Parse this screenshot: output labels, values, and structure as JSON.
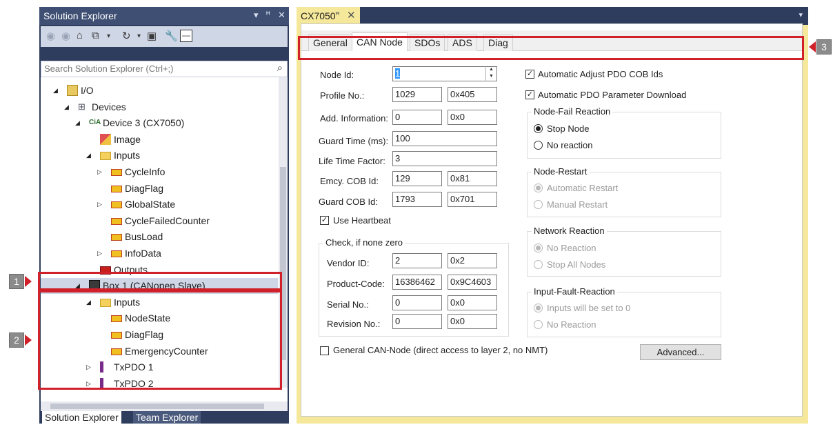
{
  "solution_explorer": {
    "title": "Solution Explorer",
    "title_controls": [
      "▾",
      "ꟸ",
      "✕"
    ],
    "search_placeholder": "Search Solution Explorer (Ctrl+;)",
    "tree": [
      {
        "label": "I/O",
        "icon": "io-folder-icon",
        "arrow": "◢"
      },
      {
        "label": "Devices",
        "icon": "devices-icon",
        "arrow": "◢"
      },
      {
        "label": "Device 3 (CX7050)",
        "icon": "cia-icon",
        "icon_text": "CiA",
        "arrow": "◢"
      },
      {
        "label": "Image",
        "icon": "image-icon",
        "arrow": ""
      },
      {
        "label": "Inputs",
        "icon": "folder-icon",
        "arrow": "◢"
      },
      {
        "label": "CycleInfo",
        "icon": "input-var-icon",
        "arrow": "▷"
      },
      {
        "label": "DiagFlag",
        "icon": "input-var-icon",
        "arrow": ""
      },
      {
        "label": "GlobalState",
        "icon": "input-var-icon",
        "arrow": "▷"
      },
      {
        "label": "CycleFailedCounter",
        "icon": "input-var-icon",
        "arrow": ""
      },
      {
        "label": "BusLoad",
        "icon": "input-var-icon",
        "arrow": ""
      },
      {
        "label": "InfoData",
        "icon": "input-var-icon",
        "arrow": "▷"
      },
      {
        "label": "Outputs",
        "icon": "outputs-icon",
        "arrow": ""
      },
      {
        "label": "Box 1 (CANopen Slave)",
        "icon": "box-icon",
        "arrow": "◢"
      },
      {
        "label": "Inputs",
        "icon": "folder-icon",
        "arrow": "◢"
      },
      {
        "label": "NodeState",
        "icon": "input-var-icon",
        "arrow": ""
      },
      {
        "label": "DiagFlag",
        "icon": "input-var-icon",
        "arrow": ""
      },
      {
        "label": "EmergencyCounter",
        "icon": "input-var-icon",
        "arrow": ""
      },
      {
        "label": "TxPDO 1",
        "icon": "txpdo-icon",
        "arrow": "▷"
      },
      {
        "label": "TxPDO 2",
        "icon": "txpdo-icon",
        "arrow": "▷"
      }
    ],
    "bottom_tabs": [
      "Solution Explorer",
      "Team Explorer"
    ]
  },
  "editor": {
    "doc_tab": "CX7050",
    "tabs": [
      "General",
      "CAN Node",
      "SDOs",
      "ADS",
      "Diag"
    ],
    "active_tab": "CAN Node",
    "fields": {
      "node_id": {
        "label": "Node Id:",
        "value": "1"
      },
      "profile_no": {
        "label": "Profile No.:",
        "dec": "1029",
        "hex": "0x405"
      },
      "add_info": {
        "label": "Add. Information:",
        "dec": "0",
        "hex": "0x0"
      },
      "guard_time": {
        "label": "Guard Time (ms):",
        "value": "100"
      },
      "life_time": {
        "label": "Life Time Factor:",
        "value": "3"
      },
      "emcy_cob": {
        "label": "Emcy. COB Id:",
        "dec": "129",
        "hex": "0x81"
      },
      "guard_cob": {
        "label": "Guard COB Id:",
        "dec": "1793",
        "hex": "0x701"
      }
    },
    "use_heartbeat": {
      "label": "Use Heartbeat",
      "checked": "✓"
    },
    "check_group": {
      "title": "Check, if none zero",
      "vendor": {
        "label": "Vendor ID:",
        "dec": "2",
        "hex": "0x2"
      },
      "product": {
        "label": "Product-Code:",
        "dec": "16386462",
        "hex": "0x9C4603"
      },
      "serial": {
        "label": "Serial No.:",
        "dec": "0",
        "hex": "0x0"
      },
      "revision": {
        "label": "Revision No.:",
        "dec": "0",
        "hex": "0x0"
      }
    },
    "auto_adjust": {
      "label": "Automatic Adjust PDO COB Ids",
      "checked": "✓"
    },
    "auto_download": {
      "label": "Automatic PDO Parameter Download",
      "checked": "✓"
    },
    "node_fail": {
      "title": "Node-Fail Reaction",
      "options": [
        "Stop Node",
        "No reaction"
      ]
    },
    "node_restart": {
      "title": "Node-Restart",
      "options": [
        "Automatic Restart",
        "Manual Restart"
      ]
    },
    "network_reaction": {
      "title": "Network Reaction",
      "options": [
        "No Reaction",
        "Stop All Nodes"
      ]
    },
    "input_fault": {
      "title": "Input-Fault-Reaction",
      "options": [
        "Inputs will be set to 0",
        "No Reaction"
      ]
    },
    "general_can": {
      "label": "General CAN-Node (direct access to layer 2, no NMT)"
    },
    "advanced_label": "Advanced..."
  },
  "callouts": [
    "1",
    "2",
    "3"
  ]
}
